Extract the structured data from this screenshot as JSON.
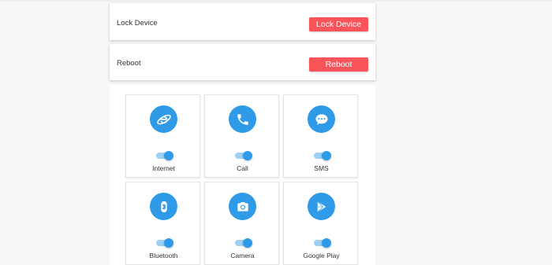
{
  "lock_card": {
    "label": "Lock Device",
    "button_label": "Lock Device"
  },
  "reboot_card": {
    "label": "Reboot",
    "button_label": "Reboot"
  },
  "features": [
    {
      "label": "Internet",
      "icon": "internet-explorer-icon",
      "enabled": true
    },
    {
      "label": "Call",
      "icon": "phone-icon",
      "enabled": true
    },
    {
      "label": "SMS",
      "icon": "sms-icon",
      "enabled": true
    },
    {
      "label": "Bluetooth",
      "icon": "bluetooth-icon",
      "enabled": true
    },
    {
      "label": "Camera",
      "icon": "camera-icon",
      "enabled": true
    },
    {
      "label": "Google Play",
      "icon": "google-play-icon",
      "enabled": true
    }
  ],
  "colors": {
    "accent": "#2f9ae8",
    "danger": "#f8545a",
    "toggle_track": "#9cd0f5"
  }
}
